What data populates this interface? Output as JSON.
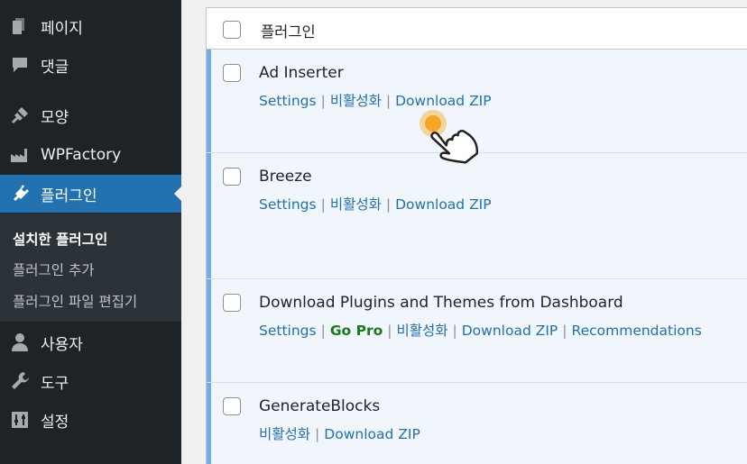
{
  "sidebar": {
    "items": [
      {
        "label": "페이지",
        "icon": "pages-icon"
      },
      {
        "label": "댓글",
        "icon": "comments-icon"
      },
      {
        "label": "모양",
        "icon": "appearance-icon"
      },
      {
        "label": "WPFactory",
        "icon": "factory-icon"
      },
      {
        "label": "플러그인",
        "icon": "plugins-icon",
        "active": true
      },
      {
        "label": "사용자",
        "icon": "users-icon"
      },
      {
        "label": "도구",
        "icon": "tools-icon"
      },
      {
        "label": "설정",
        "icon": "settings-icon"
      }
    ],
    "submenu": [
      {
        "label": "설치한 플러그인",
        "current": true
      },
      {
        "label": "플러그인 추가"
      },
      {
        "label": "플러그인 파일 편집기"
      }
    ]
  },
  "table": {
    "header": "플러그인",
    "rows": [
      {
        "name": "Ad Inserter",
        "actions": [
          "Settings",
          "비활성화",
          "Download ZIP"
        ]
      },
      {
        "name": "Breeze",
        "actions": [
          "Settings",
          "비활성화",
          "Download ZIP"
        ]
      },
      {
        "name": "Download Plugins and Themes from Dashboard",
        "actions": [
          "Settings",
          "Go Pro",
          "비활성화",
          "Download ZIP",
          "Recommendations"
        ]
      },
      {
        "name": "GenerateBlocks",
        "actions": [
          "비활성화",
          "Download ZIP"
        ]
      }
    ]
  },
  "colors": {
    "sidebar_bg": "#1d2327",
    "active_bg": "#2271b1",
    "link": "#2271b1",
    "row_bg": "#f0f6fc",
    "active_border": "#72aee6",
    "go_pro": "#1a7a1a"
  }
}
